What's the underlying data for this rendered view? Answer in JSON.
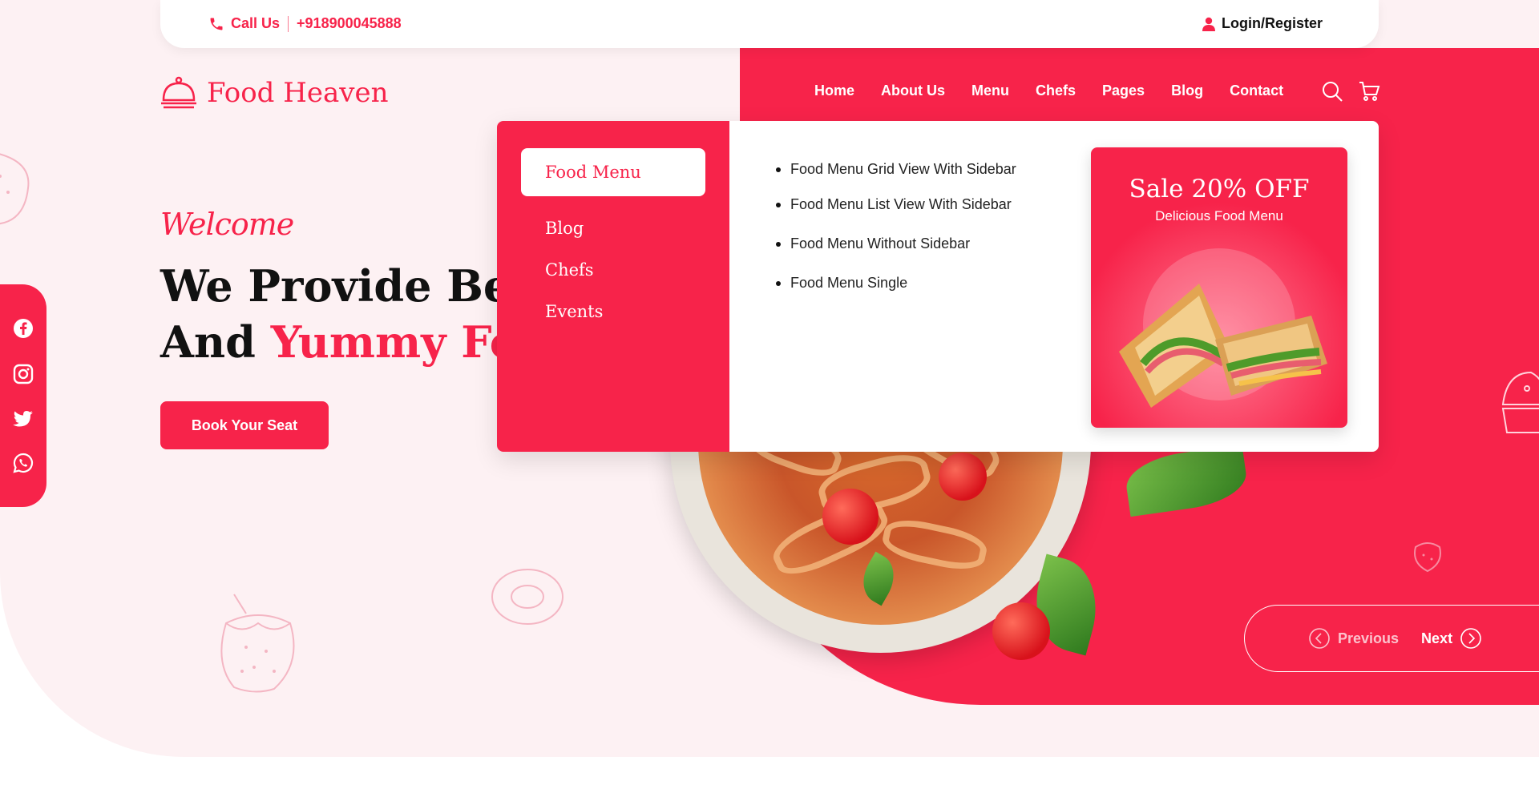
{
  "topbar": {
    "call_label": "Call Us",
    "phone": "+918900045888",
    "login_label": "Login/Register"
  },
  "brand": {
    "name": "Food Heaven"
  },
  "nav": {
    "items": [
      "Home",
      "About Us",
      "Menu",
      "Chefs",
      "Pages",
      "Blog",
      "Contact"
    ]
  },
  "hero": {
    "welcome": "Welcome",
    "title_line1": "We Provide Best",
    "title_line2_prefix": "And",
    "title_line2_accent": "Yummy Food",
    "cta": "Book Your Seat"
  },
  "social": {
    "icons": [
      "facebook-icon",
      "instagram-icon",
      "twitter-icon",
      "whatsapp-icon"
    ]
  },
  "dropdown": {
    "left_items": [
      "Food Menu",
      "Blog",
      "Chefs",
      "Events"
    ],
    "active_item": "Food Menu",
    "links": [
      "Food Menu Grid View With Sidebar",
      "Food Menu List View With Sidebar",
      "Food Menu Without Sidebar",
      "Food Menu Single"
    ],
    "promo_title": "Sale 20% OFF",
    "promo_subtitle": "Delicious Food Menu"
  },
  "slider": {
    "prev_label": "Previous",
    "next_label": "Next"
  },
  "colors": {
    "primary": "#f7234a",
    "background_pink": "#fdf1f3",
    "white": "#ffffff",
    "text": "#111111"
  }
}
